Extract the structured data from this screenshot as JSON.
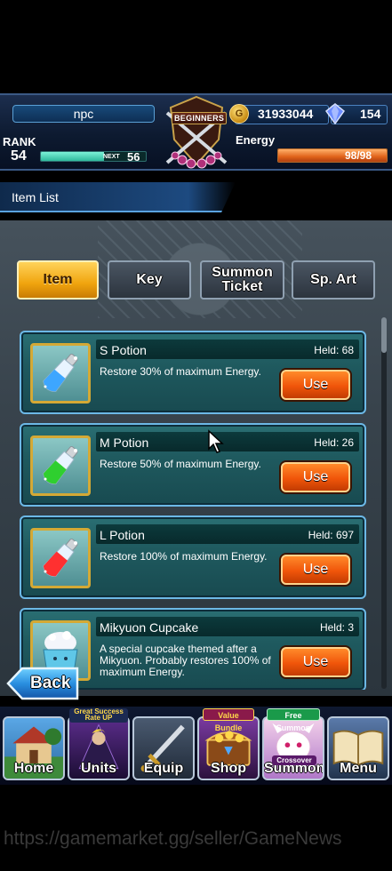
{
  "header": {
    "player_name": "npc",
    "rank_label": "RANK",
    "rank_value": "54",
    "exp_fraction": 0.6,
    "next_label": "NEXT",
    "next_value": "56",
    "emblem_text": "BEGINNERS",
    "gil": "31933044",
    "gems": "154",
    "energy_label": "Energy",
    "energy_value": "98/98",
    "energy_fraction": 1.0
  },
  "list_title": "Item List",
  "tabs": [
    {
      "label": "Item",
      "active": true
    },
    {
      "label": "Key",
      "active": false
    },
    {
      "label": "Summon Ticket",
      "active": false
    },
    {
      "label": "Sp. Art",
      "active": false
    }
  ],
  "items": [
    {
      "name": "S Potion",
      "held": "Held: 68",
      "desc": "Restore 30% of maximum Energy.",
      "use_label": "Use",
      "icon": "blue-potion-icon",
      "color": "#3da6ff"
    },
    {
      "name": "M Potion",
      "held": "Held: 26",
      "desc": "Restore 50% of maximum Energy.",
      "use_label": "Use",
      "icon": "green-potion-icon",
      "color": "#2fcf2f"
    },
    {
      "name": "L Potion",
      "held": "Held: 697",
      "desc": "Restore 100% of maximum Energy.",
      "use_label": "Use",
      "icon": "red-potion-icon",
      "color": "#ff3030"
    },
    {
      "name": "Mikyuon Cupcake",
      "held": "Held: 3",
      "desc": "A special cupcake themed after a Mikyuon. Probably restores 100% of maximum Energy.",
      "use_label": "Use",
      "icon": "cupcake-icon",
      "color": "#5fc7e8"
    }
  ],
  "back_label": "Back",
  "nav": [
    {
      "label": "Home",
      "icon": "home-icon",
      "badge": ""
    },
    {
      "label": "Units",
      "icon": "units-icon",
      "badge": "Great Success Rate UP"
    },
    {
      "label": "Equip",
      "icon": "equip-icon",
      "badge": ""
    },
    {
      "label": "Shop",
      "icon": "shop-icon",
      "badge": "Value Bundle"
    },
    {
      "label": "Summon",
      "icon": "summon-icon",
      "badge": "Free Summon",
      "sub_badge": "Crossover"
    },
    {
      "label": "Menu",
      "icon": "menu-icon",
      "badge": ""
    }
  ],
  "watermark": "https://gamemarket.gg/seller/GameNews"
}
